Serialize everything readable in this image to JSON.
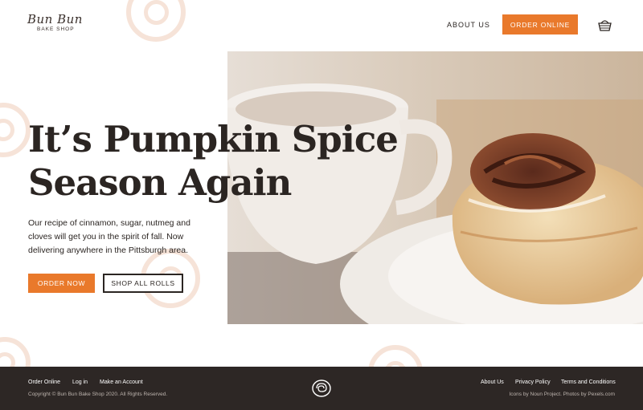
{
  "brand": {
    "name_script": "Bun Bun",
    "name_sub": "BAKE SHOP",
    "accent_color": "#e9792b",
    "dark_color": "#2d2725"
  },
  "nav": {
    "about_label": "ABOUT US",
    "order_label": "ORDER ONLINE",
    "cart_icon": "basket-icon"
  },
  "hero": {
    "title_line1": "It’s Pumpkin Spice",
    "title_line2": "Season Again",
    "description": "Our recipe of cinnamon, sugar, nutmeg and cloves will get you in the spirit of fall. Now delivering anywhere in the Pittsburgh area.",
    "primary_button": "ORDER NOW",
    "secondary_button": "SHOP ALL ROLLS",
    "image_subject": "cinnamon roll on plate beside coffee cup"
  },
  "footer": {
    "left_links": [
      "Order Online",
      "Log in",
      "Make an Account"
    ],
    "copyright": "Copyright © Bun Bun Bake Shop 2020. All Rights Reserved.",
    "right_links": [
      "About Us",
      "Privacy Policy",
      "Terms and Conditions"
    ],
    "credit": "Icons by Noun Project. Photos by Pexels.com",
    "logo_icon": "cinnamon-roll-icon"
  }
}
